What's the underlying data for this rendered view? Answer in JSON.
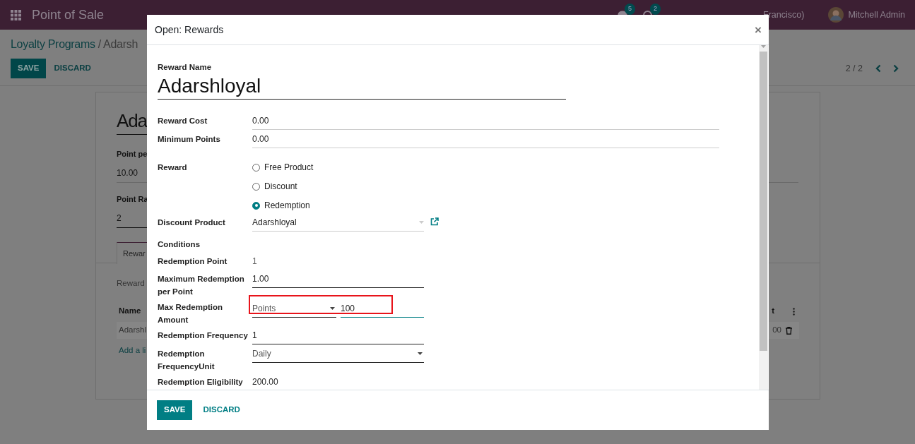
{
  "navbar": {
    "app_name": "Point of Sale",
    "messages_count": "5",
    "activities_count": "2",
    "company": "Francisco)",
    "user": "Mitchell Admin"
  },
  "control_panel": {
    "breadcrumb_parent": "Loyalty Programs",
    "breadcrumb_current": "/ Adarsh",
    "buttons": [
      "SAVE",
      "DISCARD"
    ],
    "pager": "2 / 2"
  },
  "sheet": {
    "title": "Ada",
    "fields": [
      {
        "label": "Point pe",
        "value": "10.00"
      },
      {
        "label": "Point Ra",
        "value": "2"
      }
    ],
    "tab": {
      "label": "Rewar",
      "selected": true
    },
    "section_label": "Reward",
    "table": {
      "columns": [
        "Name",
        "t"
      ],
      "row": [
        "Adarshl",
        "00"
      ],
      "add_line": "Add a li"
    }
  },
  "modal": {
    "title": "Open: Rewards",
    "close": "×",
    "name_label": "Reward Name",
    "name": "Adarshloyal",
    "fields": [
      {
        "kind": "text",
        "label": "Reward Cost",
        "value": "0.00",
        "wide": true
      },
      {
        "kind": "text",
        "label": "Minimum Points",
        "value": "0.00",
        "wide": true
      },
      {
        "kind": "radio",
        "label": "Reward",
        "options": [
          {
            "label": "Free Product",
            "selected": false
          },
          {
            "label": "Discount",
            "selected": false
          },
          {
            "label": "Redemption",
            "selected": true
          }
        ]
      },
      {
        "kind": "many2one",
        "label": "Discount Product",
        "value": "Adarshloyal"
      },
      {
        "kind": "heading",
        "label": "Conditions"
      },
      {
        "kind": "readonly",
        "label": "Redemption Point",
        "value": "1"
      },
      {
        "kind": "text",
        "label": "Maximum Redemption per Point",
        "value": "1.00",
        "wide": false
      },
      {
        "kind": "compound",
        "label": "Max Redemption Amount",
        "unit": "Points",
        "value": "100",
        "highlighted": true
      },
      {
        "kind": "text",
        "label": "Redemption Frequency",
        "value": "1",
        "wide": false
      },
      {
        "kind": "select",
        "label": "Redemption FrequencyUnit",
        "value": "Daily"
      },
      {
        "kind": "text",
        "label": "Redemption Eligibility",
        "value": "200.00",
        "wide": false
      }
    ],
    "buttons": [
      "SAVE",
      "DISCARD"
    ]
  }
}
